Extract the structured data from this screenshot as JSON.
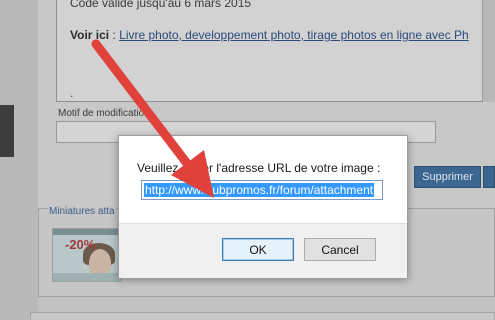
{
  "background_page": {
    "code_text": "Code valide jusqu'au 6 mars 2015",
    "voir_label": "Voir ici",
    "voir_colon": " : ",
    "voir_link": "Livre photo, developpement photo, tirage photos en ligne avec Ph",
    "dot": ".",
    "motif_label": "Motif de modification",
    "supprimer_button": "Supprimer",
    "thumbnails_label": "Miniatures atta",
    "thumbnail_promo": "-20%"
  },
  "dialog": {
    "message": "Veuillez entrer l'adresse URL de votre image :",
    "input_value": "http://www.clubpromos.fr/forum/attachment",
    "ok_label": "OK",
    "cancel_label": "Cancel"
  },
  "colors": {
    "arrow": "#e0413a",
    "selection": "#3399ff",
    "button_blue": "#3a6690"
  }
}
